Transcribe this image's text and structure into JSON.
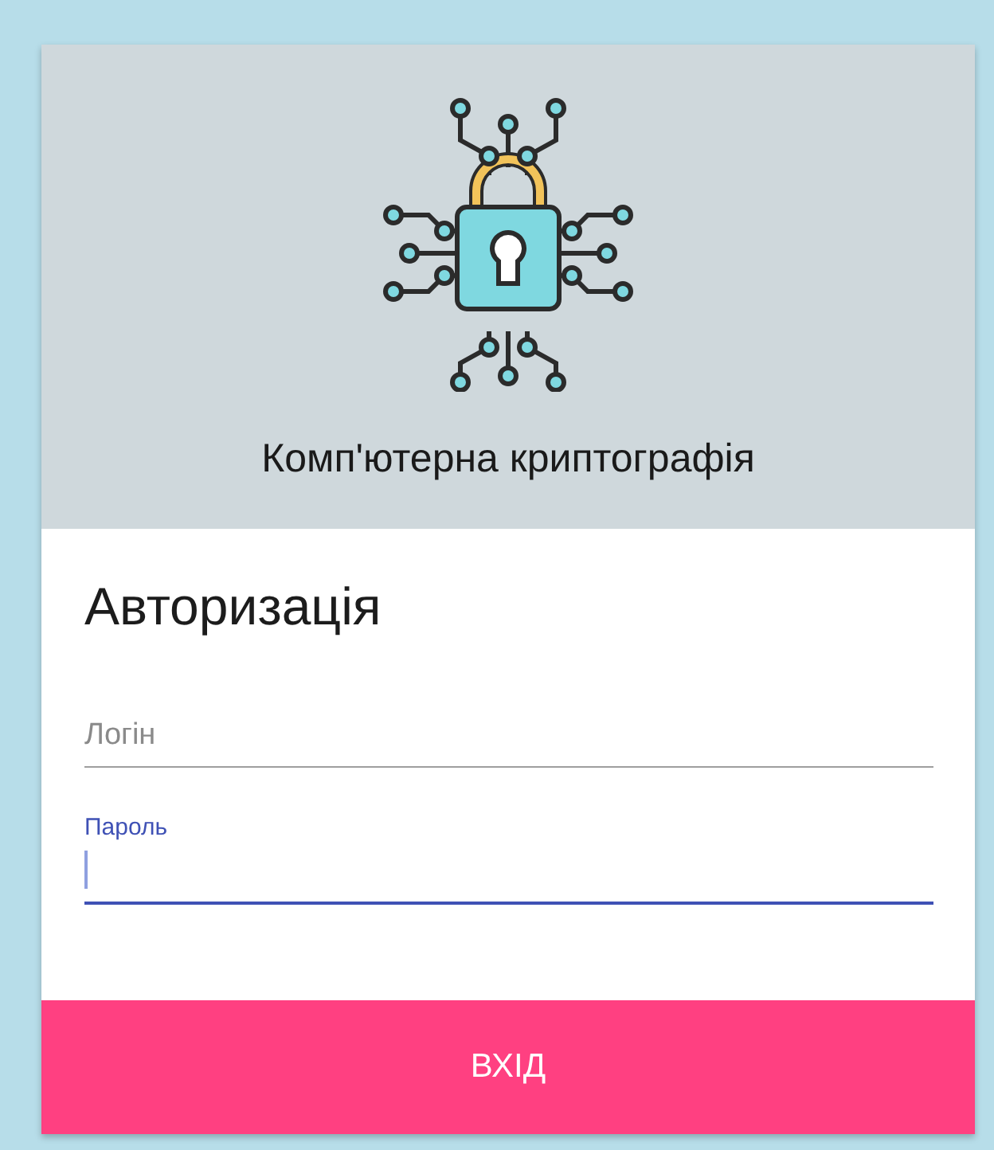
{
  "header": {
    "title": "Комп'ютерна криптографія"
  },
  "form": {
    "heading": "Авторизація",
    "fields": [
      {
        "label": "Логін",
        "focused": false
      },
      {
        "label": "Пароль",
        "focused": true
      }
    ],
    "submit": "ВХІД"
  }
}
